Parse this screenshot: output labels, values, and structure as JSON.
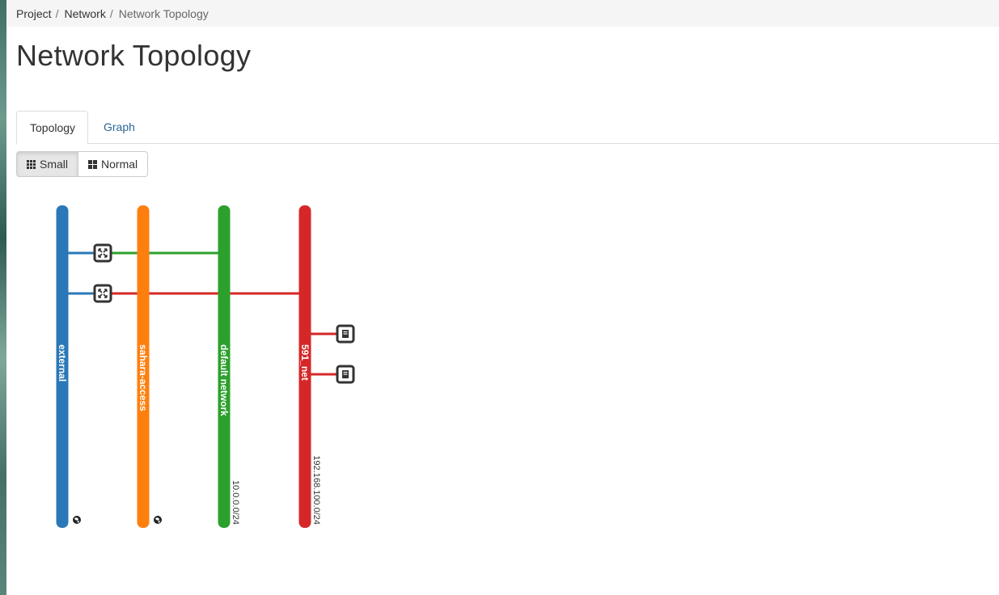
{
  "breadcrumb": {
    "items": [
      {
        "label": "Project"
      },
      {
        "label": "Network"
      },
      {
        "label": "Network Topology"
      }
    ],
    "separator": "/"
  },
  "page": {
    "title": "Network Topology"
  },
  "tabs": [
    {
      "label": "Topology",
      "active": true
    },
    {
      "label": "Graph",
      "active": false
    }
  ],
  "view_toggle": {
    "small_label": "Small",
    "normal_label": "Normal",
    "selected": "Small"
  },
  "topology": {
    "networks": [
      {
        "name": "external",
        "color": "#2a78b7",
        "external": true,
        "cidr": ""
      },
      {
        "name": "sahara-access",
        "color": "#fe7f0e",
        "external": true,
        "cidr": ""
      },
      {
        "name": "default network",
        "color": "#2ca02c",
        "external": false,
        "cidr": "10.0.0.0/24"
      },
      {
        "name": "591_net",
        "color": "#d62728",
        "external": false,
        "cidr": "192.168.100.0/24"
      }
    ],
    "routers": [
      {
        "icon": "router-icon",
        "from_network": 0,
        "to_network": 2
      },
      {
        "icon": "router-icon",
        "from_network": 0,
        "to_network": 3
      }
    ],
    "instances": [
      {
        "icon": "server-icon",
        "network": 3
      },
      {
        "icon": "server-icon",
        "network": 3
      }
    ],
    "globe_icon": "globe-icon"
  }
}
